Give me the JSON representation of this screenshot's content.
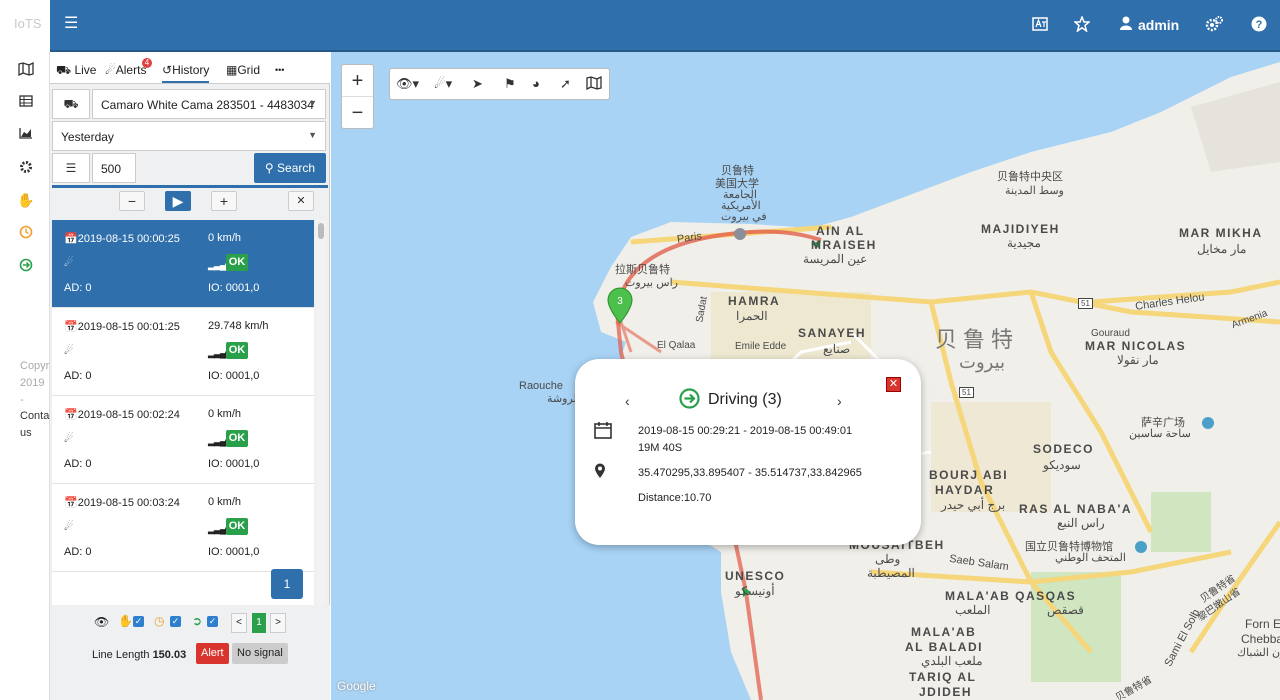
{
  "topbar": {
    "brand": "IoTS",
    "menu_icon": "hamburger-icon",
    "icons": [
      "translate-icon",
      "star-icon",
      "user-icon",
      "settings-icon",
      "help-icon"
    ],
    "user": "admin"
  },
  "leftnav": {
    "items": [
      "map-icon",
      "table-icon",
      "chart-icon",
      "gear-icon",
      "hand-icon",
      "clock-icon",
      "arrow-circle-icon"
    ],
    "copyright": "Copyright 2019",
    "dash": "-",
    "contact": "Contact us"
  },
  "panel": {
    "tabs": [
      {
        "label": "Live",
        "icon": "truck-icon"
      },
      {
        "label": "Alerts",
        "icon": "bell-icon",
        "badge": "4"
      },
      {
        "label": "History",
        "icon": "history-icon"
      },
      {
        "label": "Grid",
        "icon": "grid-icon"
      },
      {
        "label": "•••",
        "icon": "more-icon"
      }
    ],
    "vehicle": "Camaro White Cama 283501 - 4483034",
    "period": "Yesterday",
    "limit": "500",
    "search_label": "Search",
    "controls": {
      "minus": "−",
      "play": "▶",
      "plus": "+",
      "close": "✕"
    },
    "rows": [
      {
        "datetime": "2019-08-15 00:00:25",
        "speed": "0 km/h",
        "status": "OK",
        "ad": "AD: 0",
        "io": "IO: 0001,0"
      },
      {
        "datetime": "2019-08-15 00:01:25",
        "speed": "29.748 km/h",
        "status": "OK",
        "ad": "AD: 0",
        "io": "IO: 0001,0"
      },
      {
        "datetime": "2019-08-15 00:02:24",
        "speed": "0 km/h",
        "status": "OK",
        "ad": "AD: 0",
        "io": "IO: 0001,0"
      },
      {
        "datetime": "2019-08-15 00:03:24",
        "speed": "0 km/h",
        "status": "OK",
        "ad": "AD: 0",
        "io": "IO: 0001,0"
      }
    ],
    "page": "1",
    "bottom": {
      "pager_prev": "<",
      "pager_current": "1",
      "pager_next": ">",
      "line_length_label": "Line Length",
      "line_length_value": "150.03",
      "alert": "Alert",
      "no_signal": "No signal"
    }
  },
  "map": {
    "zoom_in": "+",
    "zoom_out": "−",
    "labels": {
      "aub_cn": "贝鲁特",
      "aub_cn2": "美国大学",
      "aub_ar": "الجامعة",
      "aub_ar2": "الأمريكية",
      "aub_ar3": "في بيروت",
      "ain_al": "AIN AL",
      "mraiseh": "MRAISEH",
      "mraiseh_ar": "عين المريسة",
      "downtown_cn": "贝鲁特中央区",
      "downtown_ar": "وسط المدينة",
      "majidiyeh": "MAJIDIYEH",
      "majidiyeh_ar": "مجيدية",
      "mar_mikhael": "MAR MIKHA",
      "mar_mikhael_ar": "مار مخايل",
      "hamra": "HAMRA",
      "hamra_ar": "الحمرا",
      "sanayeh": "SANAYEH",
      "sanayeh_ar": "صنايع",
      "beirut_cn": "贝鲁特",
      "beirut_ar": "بيروت",
      "mar_nicolas": "MAR NICOLAS",
      "mar_nicolas_ar": "مار نقولا",
      "ras_beirut_cn": "拉斯贝鲁特",
      "ras_beirut_ar": "راس بيروت",
      "raouche": "Raouche",
      "raouche_ar": "الروشة",
      "paris": "Paris",
      "sadat": "Sadat",
      "el_qalaa": "El Qalaa",
      "emile_edde": "Emile Edde",
      "charles_helou": "Charles Helou",
      "armenia": "Armenia",
      "gouraud": "Gouraud",
      "sassine_cn": "萨辛广场",
      "sassine_ar": "ساحة ساسين",
      "sodeco": "SODECO",
      "sodeco_ar": "سوديكو",
      "borj_abi": "BOURJ ABI",
      "haydar": "HAYDAR",
      "haydar_ar": "برج أبي حيدر",
      "ras_nabaa": "RAS AL NABA'A",
      "ras_nabaa_ar": "راس النبع",
      "museum_cn": "国立贝鲁特博物馆",
      "museum_ar": "المتحف الوطني",
      "mousaitbeh": "MOUSAITBEH",
      "mousaitbeh_ar": "المصيطبة",
      "watwat_ar": "وطى",
      "saeb_salam": "Saeb Salam",
      "unesco": "UNESCO",
      "unesco_ar": "أونيسكو",
      "malaab_qasqas": "MALA'AB QASQAS",
      "malaab_ar": "الملعب",
      "qasqas_ar": "قصقص",
      "malaab_baladi": "MALA'AB",
      "al_baladi": "AL BALADI",
      "baladi_ar": "ملعب البلدي",
      "tariq": "TARIQ AL",
      "jdideh": "JDIDEH",
      "sami_el_solh": "Sami El Solh",
      "forn": "Forn El",
      "chebbak": "Chebba",
      "chebbak_ar": "فرن الشباك",
      "road51a": "51",
      "road51b": "51",
      "road51c": "51",
      "google": "Google",
      "cn_province": "贝鲁特省",
      "cn_province2": "黎巴嫩山省",
      "sodeco_cn": "贝鲁特省"
    }
  },
  "popup": {
    "title": "Driving (3)",
    "range": "2019-08-15 00:29:21 - 2019-08-15 00:49:01",
    "duration": "19M 40S",
    "coords": "35.470295,33.895407 - 35.514737,33.842965",
    "distance": "Distance:10.70",
    "prev": "‹",
    "next": "›",
    "close": "✕"
  },
  "marker": {
    "label": "3"
  },
  "colors": {
    "primary": "#2f6fab",
    "ok": "#2aa04a",
    "alert": "#d9352e",
    "route": "#e2604e",
    "water": "#a8d3f5"
  }
}
